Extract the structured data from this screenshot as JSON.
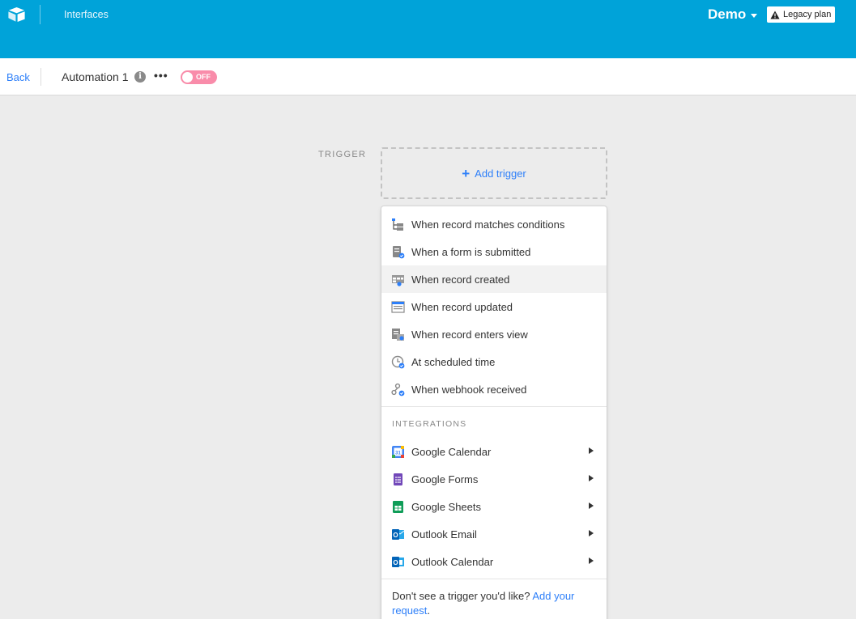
{
  "header": {
    "nav_link": "Interfaces",
    "base_name": "Demo",
    "plan_badge": "Legacy plan"
  },
  "subheader": {
    "back": "Back",
    "automation_name": "Automation 1",
    "info_glyph": "i",
    "more_glyph": "•••",
    "toggle_label": "OFF"
  },
  "builder": {
    "trigger_label": "TRIGGER",
    "add_trigger_label": "Add trigger",
    "plus_glyph": "+"
  },
  "menu": {
    "triggers": [
      {
        "label": "When record matches conditions",
        "icon": "conditions-icon"
      },
      {
        "label": "When a form is submitted",
        "icon": "form-icon"
      },
      {
        "label": "When record created",
        "icon": "record-created-icon"
      },
      {
        "label": "When record updated",
        "icon": "record-updated-icon"
      },
      {
        "label": "When record enters view",
        "icon": "enters-view-icon"
      },
      {
        "label": "At scheduled time",
        "icon": "clock-icon"
      },
      {
        "label": "When webhook received",
        "icon": "webhook-icon"
      }
    ],
    "integrations_heading": "INTEGRATIONS",
    "integrations": [
      {
        "label": "Google Calendar",
        "icon": "google-calendar-icon"
      },
      {
        "label": "Google Forms",
        "icon": "google-forms-icon"
      },
      {
        "label": "Google Sheets",
        "icon": "google-sheets-icon"
      },
      {
        "label": "Outlook Email",
        "icon": "outlook-email-icon"
      },
      {
        "label": "Outlook Calendar",
        "icon": "outlook-calendar-icon"
      }
    ],
    "footer_text": "Don't see a trigger you'd like?",
    "footer_link": "Add your request",
    "footer_end": "."
  },
  "colors": {
    "header_bg": "#00a3d9",
    "link": "#2d7ff9",
    "toggle_off": "#f98caa",
    "hover_row": "#f2f2f2"
  }
}
